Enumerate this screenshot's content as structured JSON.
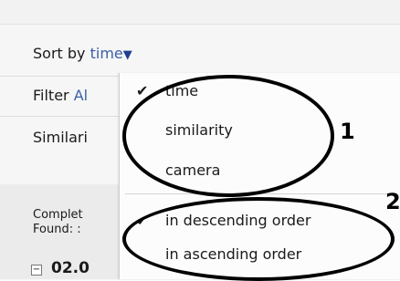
{
  "sort": {
    "label": "Sort by",
    "value": "time",
    "arrow": "▼"
  },
  "filter": {
    "label": "Filter",
    "value": "Al"
  },
  "similarity": {
    "label": "Similari"
  },
  "status": {
    "line1": "Complet",
    "line2": "Found: :"
  },
  "group": {
    "expander": "−",
    "date": "02.0"
  },
  "menu": {
    "check_glyph": "✔",
    "sort_fields": [
      {
        "label": "time",
        "checked": true
      },
      {
        "label": "similarity",
        "checked": false
      },
      {
        "label": "camera",
        "checked": false
      }
    ],
    "sort_orders": [
      {
        "label": "in descending order",
        "checked": true
      },
      {
        "label": "in ascending order",
        "checked": false
      }
    ]
  },
  "annotations": {
    "callout_1": "1",
    "callout_2": "2"
  },
  "colors": {
    "link": "#3a5fa8",
    "arrow": "#1f3f8f",
    "panel": "#f6f6f6",
    "menu": "#fcfcfc"
  }
}
